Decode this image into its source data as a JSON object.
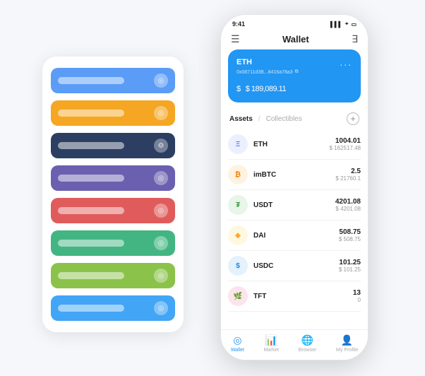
{
  "app": {
    "title": "Wallet"
  },
  "status_bar": {
    "time": "9:41",
    "signal": "▌▌▌",
    "wifi": "WiFi",
    "battery": "⬜"
  },
  "eth_card": {
    "label": "ETH",
    "address": "0x08711d3B...8416a78a3",
    "copy_icon": "⧉",
    "amount": "$ 189,089.11",
    "currency_symbol": "$",
    "dots": "..."
  },
  "assets": {
    "active_tab": "Assets",
    "divider": "/",
    "inactive_tab": "Collectibles",
    "add_icon": "+"
  },
  "asset_list": [
    {
      "name": "ETH",
      "icon_label": "Ξ",
      "icon_class": "icon-eth",
      "amount": "1004.01",
      "usd": "$ 162517.48"
    },
    {
      "name": "imBTC",
      "icon_label": "₿",
      "icon_class": "icon-imbtc",
      "amount": "2.5",
      "usd": "$ 21760.1"
    },
    {
      "name": "USDT",
      "icon_label": "₮",
      "icon_class": "icon-usdt",
      "amount": "4201.08",
      "usd": "$ 4201.08"
    },
    {
      "name": "DAI",
      "icon_label": "◈",
      "icon_class": "icon-dai",
      "amount": "508.75",
      "usd": "$ 508.75"
    },
    {
      "name": "USDC",
      "icon_label": "$",
      "icon_class": "icon-usdc",
      "amount": "101.25",
      "usd": "$ 101.25"
    },
    {
      "name": "TFT",
      "icon_label": "🌿",
      "icon_class": "icon-tft",
      "amount": "13",
      "usd": "0"
    }
  ],
  "bottom_nav": [
    {
      "label": "Wallet",
      "icon": "◎",
      "active": true
    },
    {
      "label": "Market",
      "icon": "📊",
      "active": false
    },
    {
      "label": "Browser",
      "icon": "🌐",
      "active": false
    },
    {
      "label": "My Profile",
      "icon": "👤",
      "active": false
    }
  ],
  "bg_panel": {
    "bars": [
      {
        "color": "#5b9cf6",
        "icon": "◎"
      },
      {
        "color": "#f5a623",
        "icon": "◎"
      },
      {
        "color": "#2c3e61",
        "icon": "⚙"
      },
      {
        "color": "#6b5fb0",
        "icon": "◎"
      },
      {
        "color": "#e05c5c",
        "icon": "◎"
      },
      {
        "color": "#43b583",
        "icon": "◎"
      },
      {
        "color": "#8bc34a",
        "icon": "◎"
      },
      {
        "color": "#42a5f5",
        "icon": "◎"
      }
    ]
  }
}
